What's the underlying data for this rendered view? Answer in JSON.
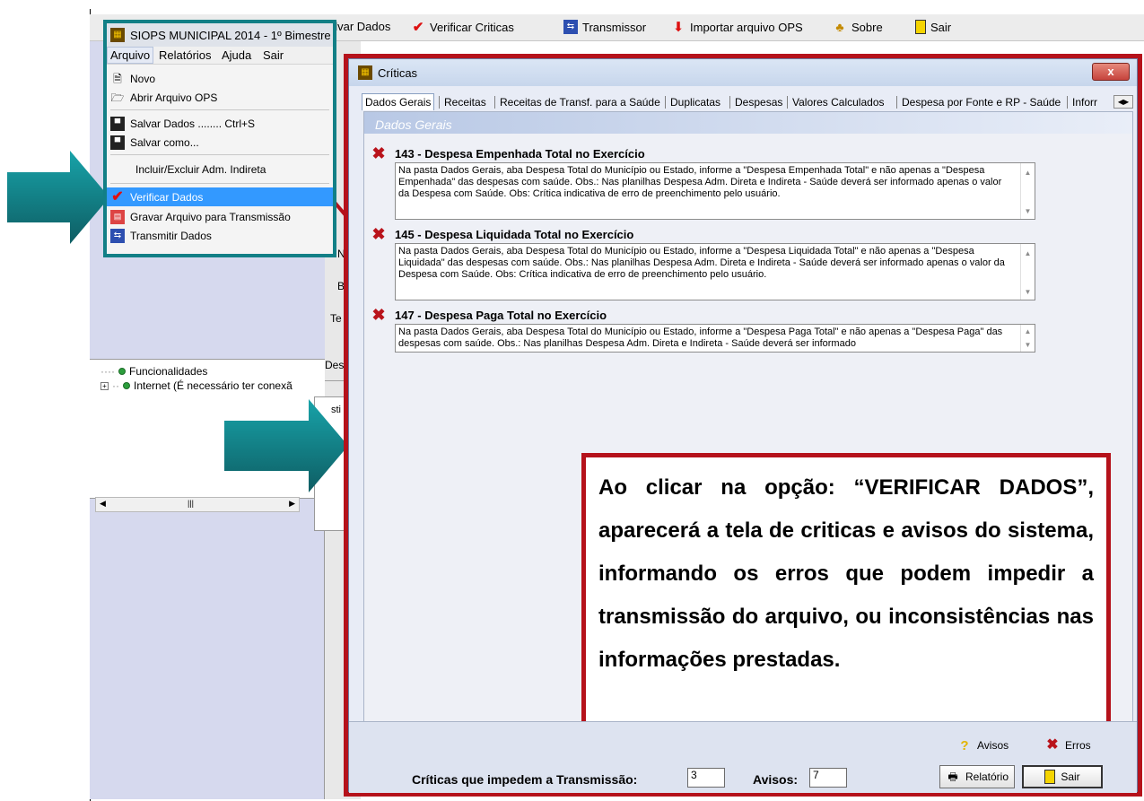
{
  "toolbar": {
    "items": [
      {
        "label": "alvar Dados",
        "icon": "save-icon"
      },
      {
        "label": "Verificar Criticas",
        "icon": "check-icon"
      },
      {
        "label": "Transmissor",
        "icon": "transmit-icon"
      },
      {
        "label": "Importar arquivo OPS",
        "icon": "import-icon"
      },
      {
        "label": "Sobre",
        "icon": "about-icon"
      },
      {
        "label": "Sair",
        "icon": "exit-icon"
      }
    ]
  },
  "background": {
    "tree_items": [
      "Funcionalidades",
      "Internet (É necessário ter conexã"
    ],
    "cut_labels": [
      "Des",
      "Te",
      "B",
      "N",
      "sti"
    ]
  },
  "menu": {
    "window_title": "SIOPS MUNICIPAL 2014 - 1º Bimestre",
    "menubar": [
      "Arquivo",
      "Relatórios",
      "Ajuda",
      "Sair"
    ],
    "items": {
      "novo": "Novo",
      "abrir": "Abrir Arquivo OPS",
      "salvar": "Salvar Dados ........ Ctrl+S",
      "salvar_como": "Salvar como...",
      "incluir": "Incluir/Excluir Adm. Indireta",
      "verificar": "Verificar Dados",
      "gravar": "Gravar Arquivo para Transmissão",
      "transmitir": "Transmitir Dados"
    }
  },
  "dialog": {
    "title": "Críticas",
    "close": "x",
    "tabs": [
      "Dados Gerais",
      "Receitas",
      "Receitas de Transf. para a Saúde",
      "Duplicatas",
      "Despesas",
      "Valores Calculados",
      "Despesa por Fonte e RP - Saúde",
      "Inforr"
    ],
    "section_title": "Dados Gerais",
    "criticas": [
      {
        "title": "143 - Despesa Empenhada Total no Exercício",
        "text": "Na pasta Dados Gerais, aba Despesa Total do Município ou Estado, informe a \"Despesa Empenhada Total\" e não apenas a \"Despesa Empenhada\" das despesas com saúde. Obs.: Nas planilhas Despesa Adm. Direta e Indireta - Saúde deverá ser informado apenas o valor da Despesa com Saúde. Obs: Crítica indicativa de erro de preenchimento pelo usuário."
      },
      {
        "title": "145 - Despesa Liquidada Total no Exercício",
        "text": "Na pasta Dados Gerais,  aba Despesa Total do Município ou Estado, informe a \"Despesa Liquidada Total\" e não apenas a \"Despesa Liquidada\" das despesas com saúde. Obs.: Nas planilhas Despesa Adm. Direta e Indireta - Saúde deverá ser informado apenas o valor da Despesa com Saúde. Obs: Crítica indicativa de erro de preenchimento pelo usuário."
      },
      {
        "title": "147 - Despesa Paga Total no Exercício",
        "text": "Na pasta Dados Gerais, aba Despesa Total do Município ou Estado, informe a \"Despesa Paga Total\" e não apenas a \"Despesa Paga\" das despesas com saúde. Obs.: Nas planilhas Despesa Adm. Direta e Indireta - Saúde deverá ser informado"
      }
    ],
    "annotation": "Ao clicar na opção:  “VERIFICAR DADOS”, aparecerá  a tela de criticas e avisos do sistema, informando os erros que podem impedir a transmissão do arquivo, ou inconsistências nas informações prestadas.",
    "legend": {
      "avisos": "Avisos",
      "erros": "Erros"
    },
    "footer": {
      "criticas_label": "Críticas que impedem a Transmissão:",
      "criticas_value": "3",
      "avisos_label": "Avisos:",
      "avisos_value": "7",
      "relatorio": "Relatório",
      "sair": "Sair"
    }
  },
  "colors": {
    "accent_red": "#b5121b",
    "arrow_teal": "#127f86",
    "highlight": "#3399ff"
  }
}
